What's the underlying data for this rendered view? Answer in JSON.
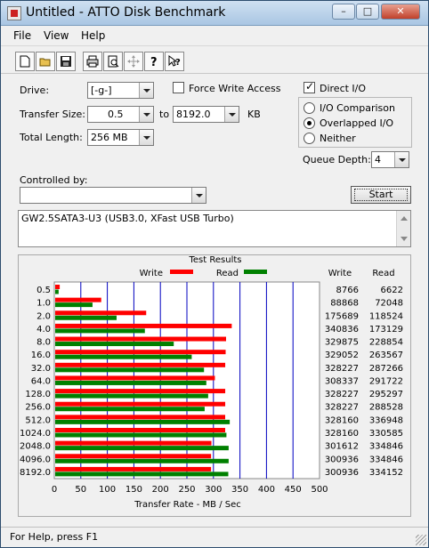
{
  "window": {
    "title": "Untitled - ATTO Disk Benchmark"
  },
  "title_buttons": {
    "minimize": "–",
    "maximize": "□",
    "close": "✕"
  },
  "menu": [
    "File",
    "View",
    "Help"
  ],
  "toolbar": {
    "icons": [
      "new-icon",
      "open-icon",
      "save-icon",
      "print-icon",
      "print-preview-icon",
      "move-icon",
      "help-icon",
      "context-help-icon"
    ]
  },
  "form": {
    "drive_label": "Drive:",
    "drive_value": "[-g-]",
    "force_write_label": "Force Write Access",
    "force_write_checked": false,
    "direct_io_label": "Direct I/O",
    "direct_io_checked": true,
    "transfer_size_label": "Transfer Size:",
    "transfer_from": "0.5",
    "to_label": "to",
    "transfer_to": "8192.0",
    "kb_label": "KB",
    "total_length_label": "Total Length:",
    "total_length_value": "256 MB",
    "io_modes": [
      {
        "label": "I/O Comparison",
        "selected": false
      },
      {
        "label": "Overlapped I/O",
        "selected": true
      },
      {
        "label": "Neither",
        "selected": false
      }
    ],
    "queue_depth_label": "Queue Depth:",
    "queue_depth_value": "4",
    "controlled_by_label": "Controlled by:",
    "controlled_by_value": "",
    "start_label": "Start",
    "description": "GW2.5SATA3-U3  (USB3.0, XFast USB Turbo)"
  },
  "results": {
    "title": "Test Results",
    "write_col": "Write",
    "read_col": "Read",
    "write_color": "#ff0000",
    "read_color": "#008000"
  },
  "chart_data": {
    "type": "bar",
    "orientation": "horizontal",
    "categories": [
      "0.5",
      "1.0",
      "2.0",
      "4.0",
      "8.0",
      "16.0",
      "32.0",
      "64.0",
      "128.0",
      "256.0",
      "512.0",
      "1024.0",
      "2048.0",
      "4096.0",
      "8192.0"
    ],
    "series": [
      {
        "name": "Write",
        "values": [
          8766,
          88868,
          175689,
          340836,
          329875,
          329052,
          328227,
          308337,
          328227,
          328227,
          328160,
          328160,
          301612,
          300936,
          300936
        ]
      },
      {
        "name": "Read",
        "values": [
          6622,
          72048,
          118524,
          173129,
          228854,
          263567,
          287266,
          291722,
          295297,
          288528,
          336948,
          330585,
          334846,
          334846,
          334152
        ]
      }
    ],
    "xlabel": "Transfer Rate - MB / Sec",
    "xticks": [
      "0",
      "50",
      "100",
      "150",
      "200",
      "250",
      "300",
      "350",
      "400",
      "450",
      "500"
    ],
    "xlim": [
      0,
      500
    ],
    "grid": true,
    "legend": "top"
  },
  "status": {
    "text": "For Help, press F1"
  }
}
